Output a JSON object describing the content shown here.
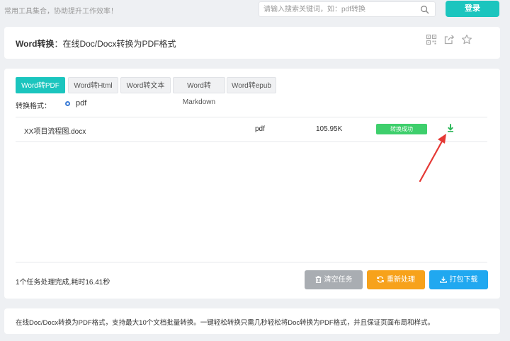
{
  "topbar": {
    "tagline": "常用工具集合，协助提升工作效率！",
    "search_placeholder": "请输入搜索关键词，如：pdf转换",
    "login_label": "登录"
  },
  "header": {
    "title_bold": "Word转换",
    "title_rest": "：在线Doc/Docx转换为PDF格式"
  },
  "tabs": [
    {
      "label": "Word转PDF",
      "active": true
    },
    {
      "label": "Word转Html",
      "active": false
    },
    {
      "label": "Word转文本",
      "active": false
    },
    {
      "label": "Word转Markdown",
      "active": false
    },
    {
      "label": "Word转epub",
      "active": false
    }
  ],
  "format": {
    "label": "转换格式：",
    "selected": "pdf"
  },
  "files": [
    {
      "name": "XX项目流程图.docx",
      "type": "pdf",
      "size": "105.95K",
      "status": "转换成功"
    }
  ],
  "footer": {
    "status_text": "1个任务处理完成,耗时16.41秒",
    "clear_label": "清空任务",
    "reprocess_label": "重新处理",
    "download_all_label": "打包下载"
  },
  "info": {
    "text": "在线Doc/Docx转换为PDF格式，支持最大10个文档批量转换。一键轻松转换只需几秒轻松将Doc转换为PDF格式，并且保证页面布局和样式。"
  },
  "colors": {
    "accent": "#1bc5be",
    "success": "#3ecf6c",
    "warning": "#f7a21b",
    "primary": "#20a8f0",
    "muted": "#a9adb2",
    "annotation": "#e53935"
  },
  "icons": {
    "search": "search-icon",
    "qrcode": "qrcode-icon",
    "share": "share-icon",
    "favorite": "star-icon",
    "download": "download-icon",
    "trash": "trash-icon",
    "refresh": "refresh-icon"
  }
}
